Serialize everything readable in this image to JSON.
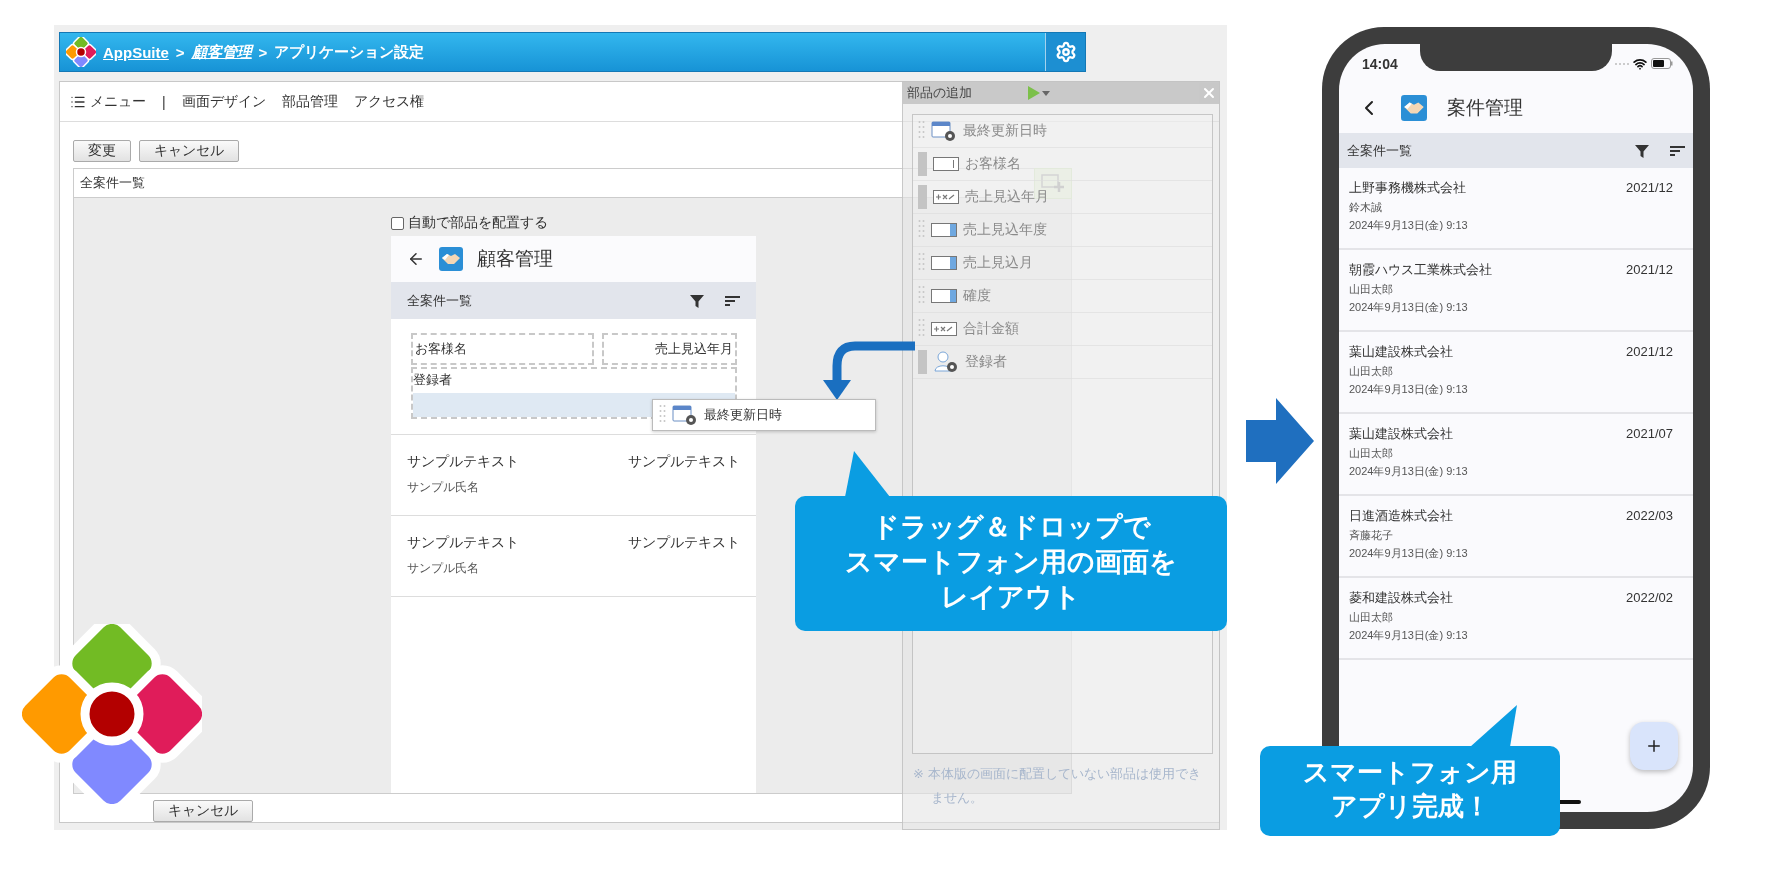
{
  "header": {
    "crumbs": [
      {
        "label": "AppSuite",
        "kind": "link"
      },
      {
        "label": "顧客管理",
        "kind": "link_italic"
      },
      {
        "label": "アプリケーション設定",
        "kind": "plain"
      }
    ],
    "separator": ">"
  },
  "menu": {
    "items": [
      "メニュー",
      "画面デザイン",
      "部品管理",
      "アクセス権"
    ],
    "separator": "|"
  },
  "toolbar_buttons": [
    "変更",
    "キャンセル"
  ],
  "view_field": {
    "value": "全案件一覧"
  },
  "auto_layout": {
    "label": "自動で部品を配置する",
    "checked": false
  },
  "preview": {
    "title": "顧客管理",
    "list_title": "全案件一覧",
    "layout_fields": [
      {
        "label": "お客様名",
        "kind": "left"
      },
      {
        "label": "売上見込年月",
        "kind": "right"
      },
      {
        "label": "登録者",
        "kind": "wide"
      }
    ],
    "rows": [
      {
        "title": "サンプルテキスト",
        "value": "サンプルテキスト",
        "sub": "サンプル氏名"
      },
      {
        "title": "サンプルテキスト",
        "value": "サンプルテキスト",
        "sub": "サンプル氏名"
      }
    ]
  },
  "dragged_part": {
    "label": "最終更新日時",
    "kind": "datetime"
  },
  "bottom_buttons": [
    "キャンセル"
  ],
  "parts_panel": {
    "title": "部品の追加",
    "items": [
      {
        "label": "最終更新日時",
        "kind": "datetime",
        "placed": false
      },
      {
        "label": "お客様名",
        "kind": "text",
        "placed": true
      },
      {
        "label": "売上見込年月",
        "kind": "number",
        "placed": true
      },
      {
        "label": "売上見込年度",
        "kind": "select",
        "placed": false
      },
      {
        "label": "売上見込月",
        "kind": "select",
        "placed": false
      },
      {
        "label": "確度",
        "kind": "select",
        "placed": false
      },
      {
        "label": "合計金額",
        "kind": "number",
        "placed": false
      },
      {
        "label": "登録者",
        "kind": "user",
        "placed": true
      }
    ],
    "note": "※ 本体版の画面に配置していない部品は使用できません。"
  },
  "callouts": [
    {
      "lines": [
        "ドラッグ＆ドロップで",
        "スマートフォン用の画面を",
        "レイアウト"
      ]
    },
    {
      "lines": [
        "スマートフォン用",
        "アプリ完成！"
      ]
    }
  ],
  "phone": {
    "time": "14:04",
    "title": "案件管理",
    "list_title": "全案件一覧",
    "rows": [
      {
        "company": "上野事務機株式会社",
        "period": "2021/12",
        "person": "鈴木誠",
        "updated": "2024年9月13日(金) 9:13"
      },
      {
        "company": "朝霞ハウス工業株式会社",
        "period": "2021/12",
        "person": "山田太郎",
        "updated": "2024年9月13日(金) 9:13"
      },
      {
        "company": "葉山建設株式会社",
        "period": "2021/12",
        "person": "山田太郎",
        "updated": "2024年9月13日(金) 9:13"
      },
      {
        "company": "葉山建設株式会社",
        "period": "2021/07",
        "person": "山田太郎",
        "updated": "2024年9月13日(金) 9:13"
      },
      {
        "company": "日進酒造株式会社",
        "period": "2022/03",
        "person": "斉藤花子",
        "updated": "2024年9月13日(金) 9:13"
      },
      {
        "company": "菱和建設株式会社",
        "period": "2022/02",
        "person": "山田太郎",
        "updated": "2024年9月13日(金) 9:13"
      }
    ]
  }
}
